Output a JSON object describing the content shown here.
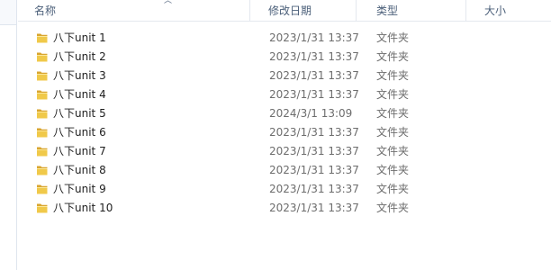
{
  "columns": {
    "name": "名称",
    "date": "修改日期",
    "type": "类型",
    "size": "大小"
  },
  "icons": {
    "folder": "folder-icon",
    "sort": "sort-ascending-icon"
  },
  "colors": {
    "folder_front": "#f0c94a",
    "folder_back": "#d9a630"
  },
  "files": [
    {
      "name": "八下unit 1",
      "date": "2023/1/31 13:37",
      "type": "文件夹",
      "size": ""
    },
    {
      "name": "八下unit 2",
      "date": "2023/1/31 13:37",
      "type": "文件夹",
      "size": ""
    },
    {
      "name": "八下unit 3",
      "date": "2023/1/31 13:37",
      "type": "文件夹",
      "size": ""
    },
    {
      "name": "八下unit 4",
      "date": "2023/1/31 13:37",
      "type": "文件夹",
      "size": ""
    },
    {
      "name": "八下unit 5",
      "date": "2024/3/1 13:09",
      "type": "文件夹",
      "size": ""
    },
    {
      "name": "八下unit 6",
      "date": "2023/1/31 13:37",
      "type": "文件夹",
      "size": ""
    },
    {
      "name": "八下unit 7",
      "date": "2023/1/31 13:37",
      "type": "文件夹",
      "size": ""
    },
    {
      "name": "八下unit 8",
      "date": "2023/1/31 13:37",
      "type": "文件夹",
      "size": ""
    },
    {
      "name": "八下unit 9",
      "date": "2023/1/31 13:37",
      "type": "文件夹",
      "size": ""
    },
    {
      "name": "八下unit 10",
      "date": "2023/1/31 13:37",
      "type": "文件夹",
      "size": ""
    }
  ]
}
